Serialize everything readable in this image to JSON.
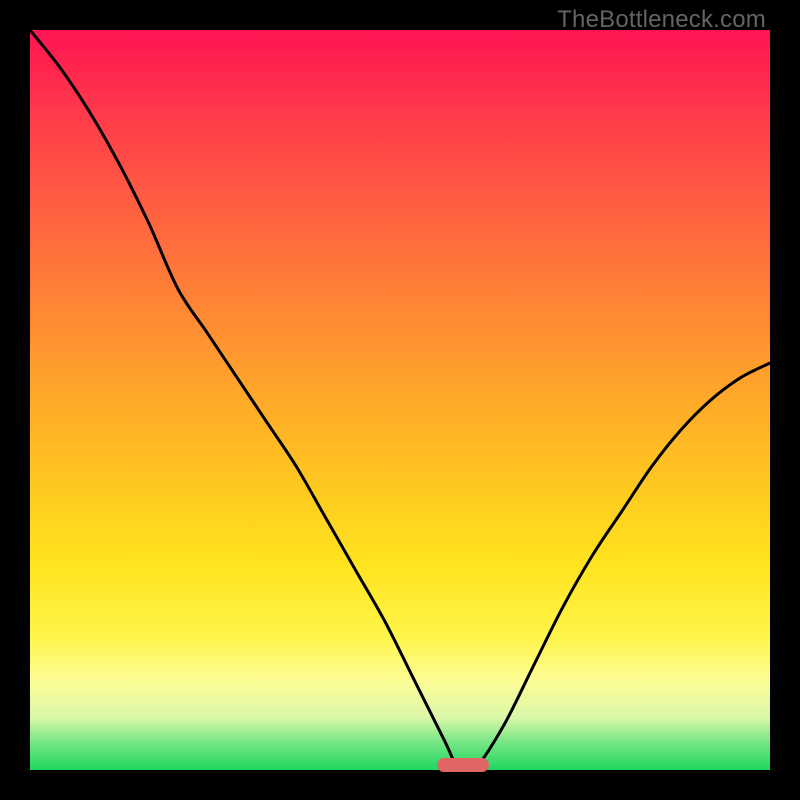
{
  "watermark": "TheBottleneck.com",
  "colors": {
    "background": "#000000",
    "curve": "#000000",
    "marker": "#e06666"
  },
  "chart_data": {
    "type": "line",
    "title": "",
    "xlabel": "",
    "ylabel": "",
    "xlim": [
      0,
      100
    ],
    "ylim": [
      0,
      100
    ],
    "x": [
      0,
      4,
      8,
      12,
      16,
      20,
      24,
      28,
      32,
      36,
      40,
      44,
      48,
      52,
      56,
      58,
      60,
      64,
      68,
      72,
      76,
      80,
      84,
      88,
      92,
      96,
      100
    ],
    "y": [
      100,
      95,
      89,
      82,
      74,
      65,
      59,
      53,
      47,
      41,
      34,
      27,
      20,
      12,
      4,
      0,
      0,
      6,
      14,
      22,
      29,
      35,
      41,
      46,
      50,
      53,
      55
    ],
    "marker": {
      "x_start": 55,
      "x_end": 62,
      "y": 0
    },
    "grid": false,
    "legend": false
  }
}
